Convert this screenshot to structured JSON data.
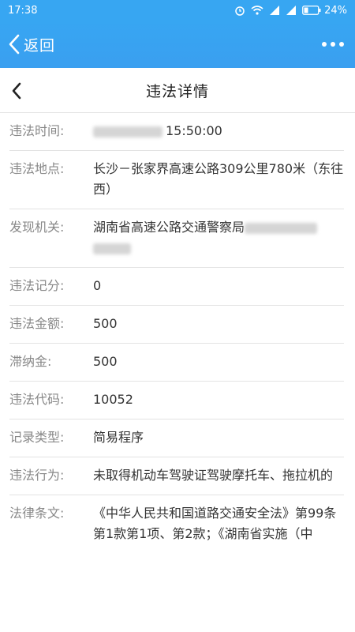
{
  "status": {
    "time": "17:38",
    "battery": "24%"
  },
  "appbar": {
    "back_label": "返回",
    "back_icon": "chevron-left-icon",
    "more_icon": "more-dots-icon"
  },
  "title": {
    "text": "违法详情"
  },
  "details": [
    {
      "label": "违法时间:",
      "value": "15:50:00"
    },
    {
      "label": "违法地点:",
      "value": "长沙－张家界高速公路309公里780米（东往西）"
    },
    {
      "label": "发现机关:",
      "value": "湖南省高速公路交通警察局"
    },
    {
      "label": "违法记分:",
      "value": "0"
    },
    {
      "label": "违法金额:",
      "value": "500"
    },
    {
      "label": "滞纳金:",
      "value": "500"
    },
    {
      "label": "违法代码:",
      "value": "10052"
    },
    {
      "label": "记录类型:",
      "value": "简易程序"
    },
    {
      "label": "违法行为:",
      "value": "未取得机动车驾驶证驾驶摩托车、拖拉机的"
    },
    {
      "label": "法律条文:",
      "value": "《中华人民共和国道路交通安全法》第99条第1款第1项、第2款；《湖南省实施（中"
    }
  ]
}
